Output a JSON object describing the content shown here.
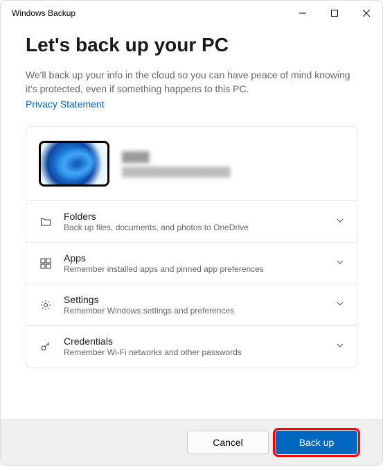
{
  "window": {
    "title": "Windows Backup"
  },
  "header": {
    "heading": "Let's back up your PC",
    "description": "We'll back up your info in the cloud so you can have peace of mind knowing it's protected, even if something happens to this PC.",
    "privacy": "Privacy Statement"
  },
  "profile": {
    "name": "████",
    "sub": "█████████████████"
  },
  "items": [
    {
      "title": "Folders",
      "sub": "Back up files, documents, and photos to OneDrive"
    },
    {
      "title": "Apps",
      "sub": "Remember installed apps and pinned app preferences"
    },
    {
      "title": "Settings",
      "sub": "Remember Windows settings and preferences"
    },
    {
      "title": "Credentials",
      "sub": "Remember Wi-Fi networks and other passwords"
    }
  ],
  "footer": {
    "cancel": "Cancel",
    "backup": "Back up"
  }
}
